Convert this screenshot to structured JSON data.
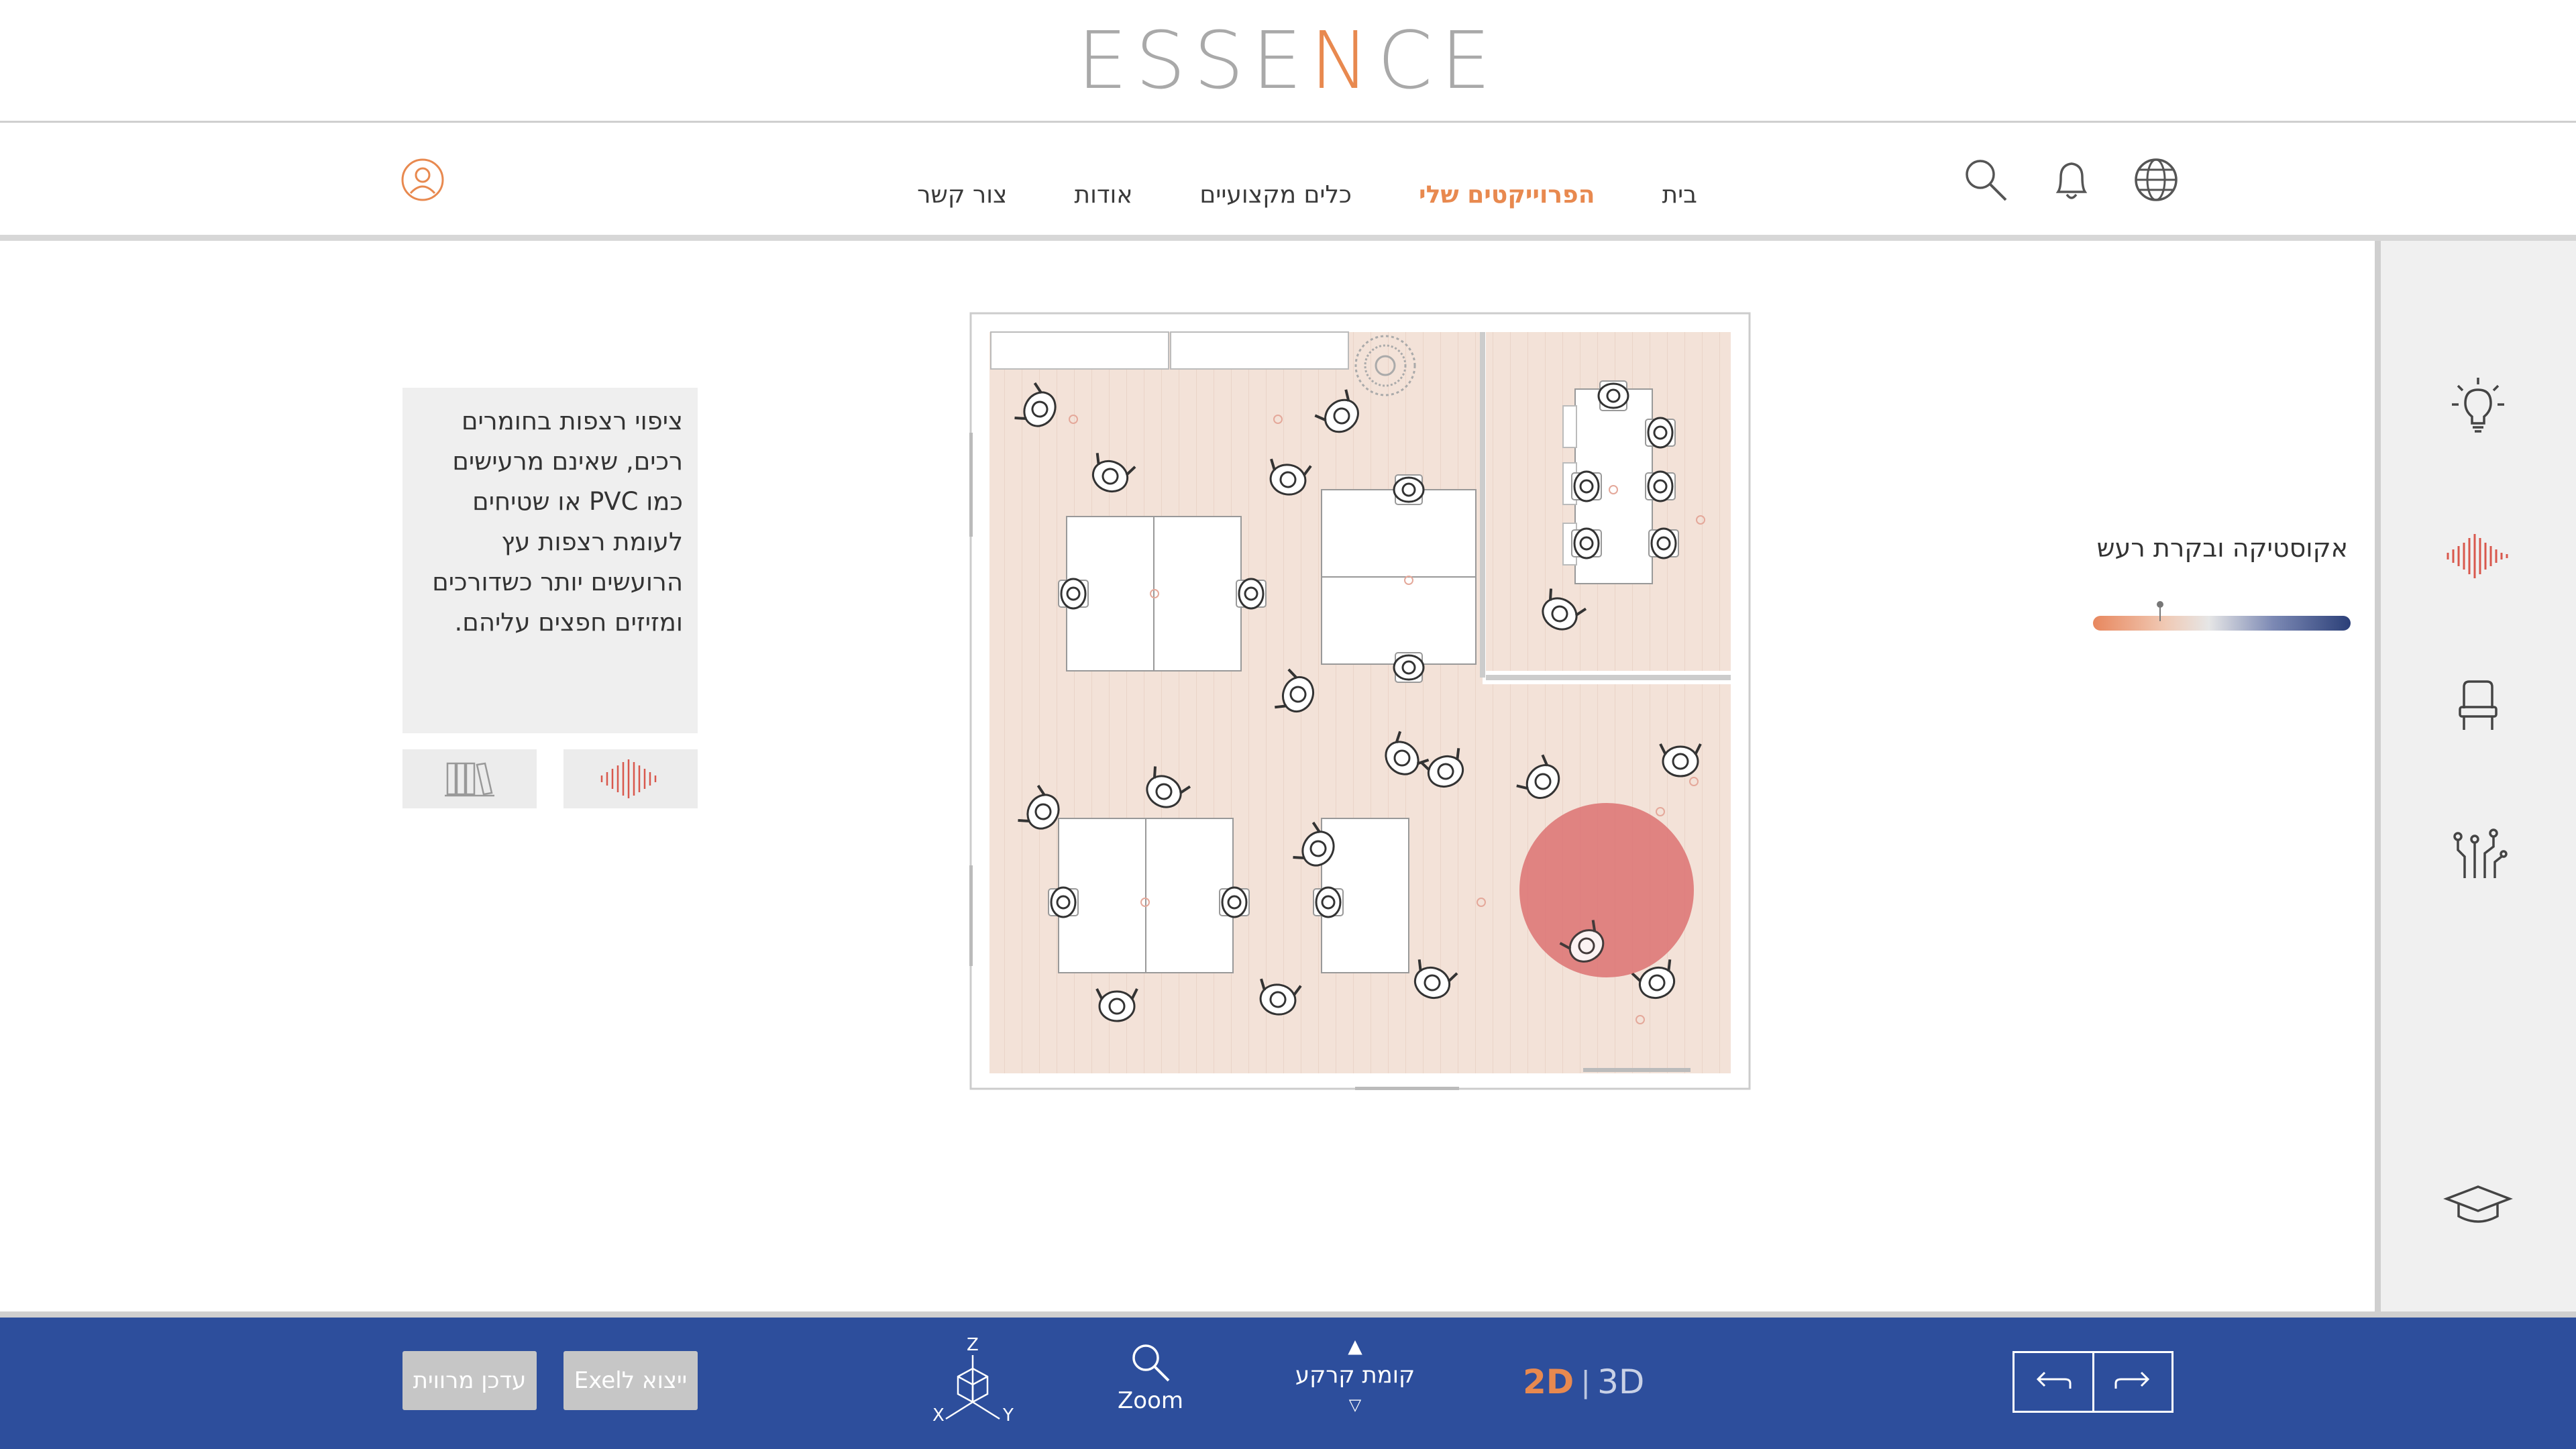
{
  "brand": {
    "logo_pre": "ESSE",
    "logo_accent": "N",
    "logo_post": "CE",
    "accent_color": "#e8894f"
  },
  "nav": {
    "items": [
      {
        "label": "בית",
        "active": false
      },
      {
        "label": "הפרוייקטים שלי",
        "active": true
      },
      {
        "label": "כלים מקצועיים",
        "active": false
      },
      {
        "label": "אודות",
        "active": false
      },
      {
        "label": "צור קשר",
        "active": false
      }
    ]
  },
  "header_icons": [
    "user-icon",
    "search-icon",
    "bell-icon",
    "globe-icon"
  ],
  "sidebar": {
    "icons": [
      "lightbulb-icon",
      "sound-wave-icon",
      "chair-icon",
      "circuit-icon",
      "graduation-cap-icon"
    ],
    "active": "sound-wave-icon"
  },
  "acoustics": {
    "label": "אקוסטיקה ובקרת רעש",
    "slider_fraction": 0.26
  },
  "info": {
    "text": "ציפוי רצפות בחומרים רכים, שאינם מרעישים כמו PVC או שטיחים לעומת רצפות עץ הרועשים יותר כשדורכים ומזיזים חפצים עליהם.",
    "buttons": [
      "books-icon",
      "sound-wave-icon"
    ]
  },
  "bottom": {
    "btn_update": "עדכן מרווית",
    "btn_export": "ייצוא לExel",
    "axes": {
      "z": "Z",
      "x": "X",
      "y": "Y"
    },
    "zoom": "Zoom",
    "floor": "קומת קרקע",
    "dim_2d": "2D",
    "dim_sep": "|",
    "dim_3d": "3D",
    "bar_color": "#2d4e9c"
  },
  "colors": {
    "floor": "#f3e2d8",
    "noise_zone": "#dc7272"
  }
}
